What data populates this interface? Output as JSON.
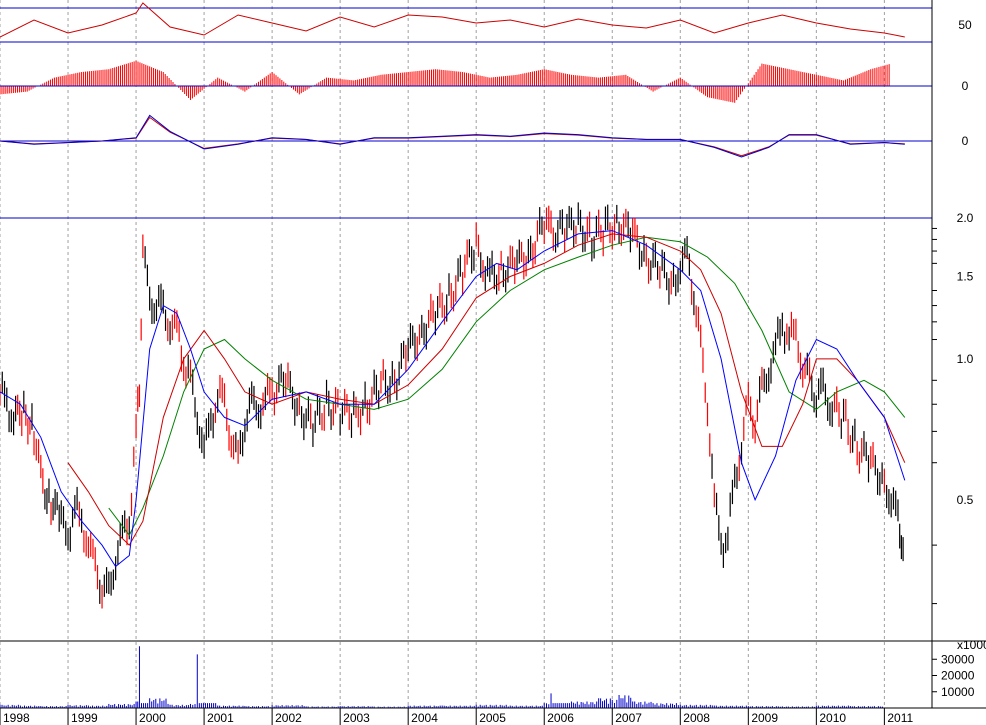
{
  "chart_data": [
    {
      "panel": "oscillator-1",
      "type": "line",
      "ylim": [
        15,
        75
      ],
      "ticks": [
        {
          "value": 50,
          "label": "50"
        }
      ],
      "reference_lines": [
        33,
        67
      ],
      "colors": {
        "line": "#cc0000",
        "ref": "#0000cc"
      },
      "series": [
        {
          "x": [
            1998.0,
            1998.5,
            1999.0,
            1999.5,
            2000.0,
            2000.1,
            2000.5,
            2001.0,
            2001.5,
            2002.0,
            2002.5,
            2003.0,
            2003.5,
            2004.0,
            2004.5,
            2005.0,
            2005.5,
            2006.0,
            2006.5,
            2007.0,
            2007.5,
            2008.0,
            2008.5,
            2009.0,
            2009.5,
            2010.0,
            2010.5,
            2011.0,
            2011.3
          ],
          "values": [
            38,
            55,
            42,
            50,
            62,
            72,
            48,
            40,
            60,
            52,
            44,
            58,
            48,
            60,
            58,
            52,
            55,
            48,
            56,
            50,
            47,
            55,
            42,
            52,
            60,
            52,
            46,
            42,
            38
          ]
        }
      ]
    },
    {
      "panel": "oscillator-2",
      "type": "bar",
      "ylim": [
        -1,
        1
      ],
      "ticks": [
        {
          "value": 0,
          "label": "0"
        }
      ],
      "colors": {
        "bar": "#ff0000",
        "zero": "#0000cc"
      },
      "x": [
        1998.0,
        1998.4,
        1998.8,
        1999.2,
        1999.6,
        2000.0,
        2000.4,
        2000.8,
        2001.2,
        2001.6,
        2002.0,
        2002.4,
        2002.8,
        2003.2,
        2003.6,
        2004.0,
        2004.4,
        2004.8,
        2005.2,
        2005.6,
        2006.0,
        2006.4,
        2006.8,
        2007.2,
        2007.6,
        2008.0,
        2008.4,
        2008.8,
        2009.2,
        2009.6,
        2010.0,
        2010.4,
        2010.8,
        2011.1
      ],
      "values": [
        -0.3,
        -0.2,
        0.3,
        0.5,
        0.6,
        0.9,
        0.5,
        -0.5,
        0.3,
        -0.2,
        0.5,
        -0.3,
        0.3,
        0.2,
        0.4,
        0.5,
        0.6,
        0.5,
        0.3,
        0.4,
        0.6,
        0.4,
        0.3,
        0.4,
        -0.2,
        0.3,
        -0.4,
        -0.6,
        0.8,
        0.6,
        0.4,
        0.2,
        0.6,
        0.8
      ]
    },
    {
      "panel": "oscillator-3",
      "type": "line",
      "ylim": [
        -1,
        1
      ],
      "ticks": [
        {
          "value": 0,
          "label": "0"
        }
      ],
      "colors": {
        "line": "#0000cc",
        "signal": "#cc0000",
        "zero": "#0000cc"
      },
      "series": [
        {
          "x": [
            1998.0,
            1998.5,
            1999.0,
            1999.5,
            2000.0,
            2000.2,
            2000.5,
            2001.0,
            2001.5,
            2002.0,
            2002.5,
            2003.0,
            2003.5,
            2004.0,
            2004.5,
            2005.0,
            2005.5,
            2006.0,
            2006.5,
            2007.0,
            2007.5,
            2008.0,
            2008.5,
            2008.9,
            2009.3,
            2009.6,
            2010.0,
            2010.5,
            2011.0,
            2011.3
          ],
          "values": [
            0,
            -0.1,
            -0.05,
            0.0,
            0.1,
            0.8,
            0.3,
            -0.25,
            -0.1,
            0.1,
            0.05,
            -0.1,
            0.1,
            0.1,
            0.15,
            0.2,
            0.15,
            0.25,
            0.2,
            0.1,
            0.05,
            0.05,
            -0.2,
            -0.5,
            -0.2,
            0.2,
            0.2,
            -0.1,
            -0.05,
            -0.1
          ]
        }
      ]
    },
    {
      "panel": "price",
      "type": "line",
      "scale": "log",
      "ylim": [
        0.27,
        2.05
      ],
      "ticks": [
        {
          "value": 0.5,
          "label": "0.5"
        },
        {
          "value": 1.0,
          "label": "1.0"
        },
        {
          "value": 1.5,
          "label": "1.5"
        },
        {
          "value": 2.0,
          "label": "2.0"
        }
      ],
      "minor_ticks": [
        0.3,
        0.4,
        0.6,
        0.7,
        0.8,
        0.9,
        1.1,
        1.2,
        1.3,
        1.4,
        1.6,
        1.7,
        1.8,
        1.9
      ],
      "xlim": [
        1998.0,
        2011.7
      ],
      "x_ticks": [
        1998,
        1999,
        2000,
        2001,
        2002,
        2003,
        2004,
        2005,
        2006,
        2007,
        2008,
        2009,
        2010,
        2011
      ],
      "grid": true,
      "colors": {
        "price_up": "#000000",
        "price_down": "#ff0000",
        "ma_short": "#0000ff",
        "ma_mid": "#cc0000",
        "ma_long": "#008000",
        "ref": "#0000cc"
      },
      "price": {
        "x": [
          1998.0,
          1998.1,
          1998.2,
          1998.35,
          1998.5,
          1998.6,
          1998.75,
          1998.9,
          1999.0,
          1999.1,
          1999.2,
          1999.3,
          1999.4,
          1999.5,
          1999.6,
          1999.7,
          1999.8,
          1999.9,
          2000.0,
          2000.05,
          2000.1,
          2000.2,
          2000.3,
          2000.4,
          2000.5,
          2000.6,
          2000.7,
          2000.8,
          2000.9,
          2001.0,
          2001.1,
          2001.2,
          2001.3,
          2001.4,
          2001.5,
          2001.6,
          2001.7,
          2001.8,
          2001.9,
          2002.0,
          2002.2,
          2002.4,
          2002.6,
          2002.8,
          2003.0,
          2003.2,
          2003.4,
          2003.6,
          2003.8,
          2004.0,
          2004.2,
          2004.4,
          2004.6,
          2004.8,
          2005.0,
          2005.1,
          2005.2,
          2005.4,
          2005.6,
          2005.8,
          2006.0,
          2006.1,
          2006.3,
          2006.5,
          2006.7,
          2006.9,
          2007.1,
          2007.3,
          2007.5,
          2007.7,
          2007.9,
          2008.0,
          2008.1,
          2008.2,
          2008.3,
          2008.4,
          2008.5,
          2008.6,
          2008.7,
          2008.8,
          2008.9,
          2009.0,
          2009.1,
          2009.2,
          2009.3,
          2009.4,
          2009.5,
          2009.6,
          2009.7,
          2009.8,
          2009.9,
          2010.0,
          2010.1,
          2010.2,
          2010.4,
          2010.6,
          2010.8,
          2011.0,
          2011.1,
          2011.2,
          2011.25,
          2011.3
        ],
        "values": [
          0.85,
          0.8,
          0.75,
          0.78,
          0.7,
          0.55,
          0.5,
          0.45,
          0.42,
          0.48,
          0.45,
          0.4,
          0.36,
          0.33,
          0.31,
          0.38,
          0.42,
          0.45,
          0.7,
          0.85,
          1.75,
          1.3,
          1.35,
          1.25,
          1.2,
          1.15,
          1.0,
          0.9,
          0.75,
          0.65,
          0.72,
          0.85,
          0.8,
          0.68,
          0.6,
          0.75,
          0.8,
          0.78,
          0.82,
          0.85,
          0.9,
          0.78,
          0.72,
          0.8,
          0.78,
          0.76,
          0.8,
          0.88,
          0.9,
          1.05,
          1.15,
          1.25,
          1.35,
          1.55,
          1.75,
          1.6,
          1.5,
          1.55,
          1.6,
          1.7,
          1.95,
          1.85,
          1.9,
          1.95,
          1.8,
          1.9,
          1.95,
          1.85,
          1.65,
          1.55,
          1.45,
          1.6,
          1.65,
          1.4,
          1.05,
          0.8,
          0.5,
          0.4,
          0.42,
          0.55,
          0.65,
          0.8,
          0.75,
          0.85,
          0.95,
          1.05,
          1.2,
          1.1,
          1.15,
          0.95,
          0.9,
          0.85,
          0.85,
          0.8,
          0.75,
          0.65,
          0.6,
          0.55,
          0.5,
          0.45,
          0.42,
          0.35
        ]
      },
      "ma_short": {
        "x": [
          1998.0,
          1998.3,
          1998.6,
          1998.9,
          1999.2,
          1999.5,
          1999.7,
          1999.9,
          2000.0,
          2000.2,
          2000.4,
          2000.6,
          2000.8,
          2001.0,
          2001.3,
          2001.6,
          2002.0,
          2002.5,
          2003.0,
          2003.5,
          2004.0,
          2004.5,
          2005.0,
          2005.3,
          2005.6,
          2006.0,
          2006.5,
          2007.0,
          2007.5,
          2008.0,
          2008.3,
          2008.6,
          2008.9,
          2009.1,
          2009.4,
          2009.7,
          2010.0,
          2010.3,
          2010.6,
          2011.0,
          2011.3
        ],
        "values": [
          0.85,
          0.8,
          0.68,
          0.52,
          0.45,
          0.4,
          0.36,
          0.38,
          0.5,
          1.05,
          1.3,
          1.25,
          1.05,
          0.85,
          0.75,
          0.72,
          0.82,
          0.85,
          0.8,
          0.8,
          0.95,
          1.2,
          1.5,
          1.6,
          1.55,
          1.7,
          1.85,
          1.88,
          1.75,
          1.55,
          1.4,
          1.0,
          0.6,
          0.5,
          0.62,
          0.9,
          1.1,
          1.05,
          0.9,
          0.75,
          0.55
        ]
      },
      "ma_mid": {
        "x": [
          1999.0,
          1999.3,
          1999.6,
          1999.9,
          2000.1,
          2000.4,
          2000.7,
          2001.0,
          2001.3,
          2001.6,
          2002.0,
          2002.5,
          2003.0,
          2003.5,
          2004.0,
          2004.5,
          2005.0,
          2005.5,
          2006.0,
          2006.5,
          2007.0,
          2007.5,
          2008.0,
          2008.3,
          2008.6,
          2008.9,
          2009.2,
          2009.5,
          2009.8,
          2010.0,
          2010.3,
          2010.6,
          2011.0,
          2011.3
        ],
        "values": [
          0.6,
          0.52,
          0.44,
          0.4,
          0.45,
          0.75,
          1.0,
          1.15,
          1.0,
          0.85,
          0.8,
          0.85,
          0.82,
          0.8,
          0.88,
          1.05,
          1.35,
          1.5,
          1.6,
          1.75,
          1.85,
          1.82,
          1.7,
          1.55,
          1.25,
          0.85,
          0.65,
          0.65,
          0.8,
          1.0,
          1.0,
          0.9,
          0.75,
          0.6
        ]
      },
      "ma_long": {
        "x": [
          1999.6,
          1999.9,
          2000.1,
          2000.4,
          2000.7,
          2001.0,
          2001.3,
          2001.6,
          2002.0,
          2002.5,
          2003.0,
          2003.5,
          2004.0,
          2004.5,
          2005.0,
          2005.5,
          2006.0,
          2006.5,
          2007.0,
          2007.5,
          2008.0,
          2008.4,
          2008.8,
          2009.2,
          2009.6,
          2010.0,
          2010.3,
          2010.7,
          2011.0,
          2011.3
        ],
        "values": [
          0.48,
          0.42,
          0.48,
          0.62,
          0.85,
          1.05,
          1.1,
          1.0,
          0.9,
          0.82,
          0.8,
          0.78,
          0.82,
          0.95,
          1.2,
          1.4,
          1.55,
          1.65,
          1.75,
          1.82,
          1.78,
          1.65,
          1.45,
          1.15,
          0.85,
          0.78,
          0.85,
          0.9,
          0.85,
          0.75
        ]
      },
      "reference_lines": [
        2.0
      ]
    },
    {
      "panel": "volume",
      "type": "bar",
      "ylim": [
        0,
        40000
      ],
      "ticks": [
        {
          "value": 10000,
          "label": "10000"
        },
        {
          "value": 20000,
          "label": "20000"
        },
        {
          "value": 30000,
          "label": "30000"
        }
      ],
      "unit_label": "x1000",
      "colors": {
        "bar": "#0000cc"
      },
      "x": [
        1998.0,
        1998.3,
        1998.6,
        1999.0,
        1999.3,
        1999.6,
        2000.0,
        2000.05,
        2000.2,
        2000.5,
        2000.8,
        2000.9,
        2001.2,
        2001.6,
        2002.0,
        2002.5,
        2003.0,
        2003.5,
        2004.0,
        2004.5,
        2005.0,
        2005.5,
        2006.0,
        2006.1,
        2006.4,
        2006.8,
        2007.0,
        2007.1,
        2007.3,
        2007.6,
        2008.0,
        2008.5,
        2009.0,
        2009.5,
        2010.0,
        2010.5,
        2011.0
      ],
      "values": [
        2000,
        1500,
        1200,
        1800,
        1500,
        2500,
        4000,
        38000,
        6000,
        2000,
        2500,
        33000,
        1500,
        1200,
        1800,
        1000,
        1200,
        900,
        1500,
        1500,
        2000,
        1500,
        3000,
        9000,
        4000,
        6000,
        5000,
        8000,
        4000,
        3000,
        2000,
        1500,
        1200,
        1000,
        1500,
        1200,
        1000
      ]
    }
  ]
}
